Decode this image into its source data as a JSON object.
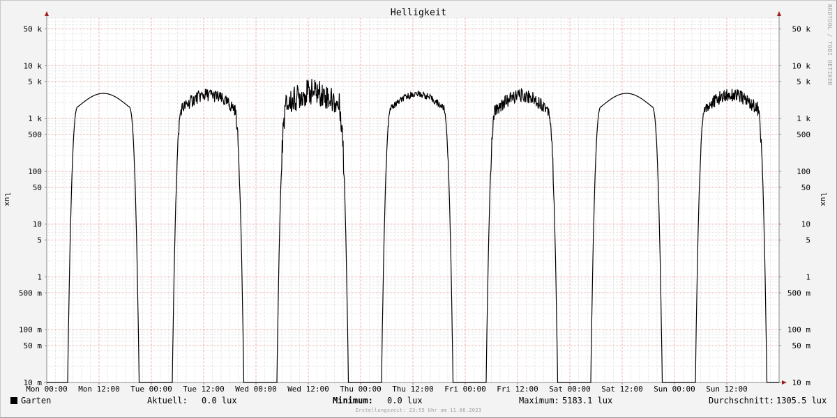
{
  "chart_data": {
    "type": "line",
    "title": "Helligkeit",
    "ylabel": "lux",
    "scale": "log",
    "ylim": [
      0.01,
      80000
    ],
    "y_ticks": [
      {
        "value": 0.01,
        "label": "10 m"
      },
      {
        "value": 0.05,
        "label": "50 m"
      },
      {
        "value": 0.1,
        "label": "100 m"
      },
      {
        "value": 0.5,
        "label": "500 m"
      },
      {
        "value": 1,
        "label": "1"
      },
      {
        "value": 5,
        "label": "5"
      },
      {
        "value": 10,
        "label": "10"
      },
      {
        "value": 50,
        "label": "50"
      },
      {
        "value": 100,
        "label": "100"
      },
      {
        "value": 500,
        "label": "500"
      },
      {
        "value": 1000,
        "label": "1 k"
      },
      {
        "value": 5000,
        "label": "5 k"
      },
      {
        "value": 10000,
        "label": "10 k"
      },
      {
        "value": 50000,
        "label": "50 k"
      }
    ],
    "x_ticks": [
      "Mon 00:00",
      "Mon 12:00",
      "Tue 00:00",
      "Tue 12:00",
      "Wed 00:00",
      "Wed 12:00",
      "Thu 00:00",
      "Thu 12:00",
      "Fri 00:00",
      "Fri 12:00",
      "Sat 00:00",
      "Sat 12:00",
      "Sun 00:00",
      "Sun 12:00"
    ],
    "xlim": [
      "Mon 00:00",
      "Sun 24:00"
    ],
    "grid": true,
    "series": [
      {
        "name": "Garten",
        "color": "#000000",
        "days": [
          {
            "day": "Mon",
            "rise": 4.8,
            "set": 21.2,
            "peak": 3000,
            "noise": 0
          },
          {
            "day": "Tue",
            "rise": 4.8,
            "set": 21.2,
            "peak": 3000,
            "noise": 1
          },
          {
            "day": "Wed",
            "rise": 4.8,
            "set": 21.2,
            "peak": 3600,
            "noise": 2
          },
          {
            "day": "Thu",
            "rise": 4.8,
            "set": 21.2,
            "peak": 3000,
            "noise": 0.5
          },
          {
            "day": "Fri",
            "rise": 4.8,
            "set": 21.2,
            "peak": 2900,
            "noise": 1
          },
          {
            "day": "Sat",
            "rise": 4.8,
            "set": 21.2,
            "peak": 3000,
            "noise": 0
          },
          {
            "day": "Sun",
            "rise": 4.8,
            "set": 21.2,
            "peak": 3000,
            "noise": 1
          }
        ]
      }
    ]
  },
  "legend": {
    "series_label": "Garten",
    "current_label": "Aktuell:",
    "current_value": "0.0 lux",
    "min_label": "Minimum:",
    "min_value": "0.0 lux",
    "max_label": "Maximum:",
    "max_value": "5183.1 lux",
    "avg_label": "Durchschnitt:",
    "avg_value": "1305.5 lux"
  },
  "watermark": "RRDTOOL / TOBI OETIKER",
  "footer": "Erstellungszeit: 23:55 Uhr am 11.06.2023"
}
